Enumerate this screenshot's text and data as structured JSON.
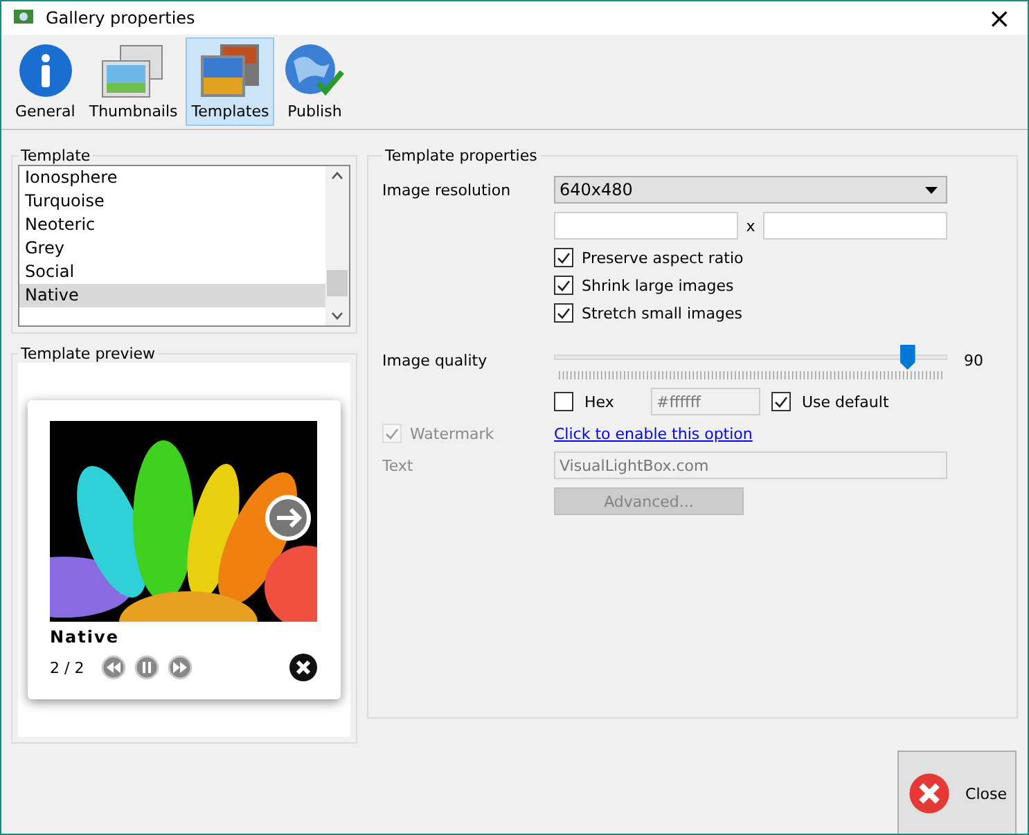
{
  "window": {
    "title": "Gallery properties",
    "close": "×"
  },
  "toolbar": [
    {
      "label": "General",
      "kind": "info",
      "selected": false
    },
    {
      "label": "Thumbnails",
      "kind": "photos",
      "selected": false
    },
    {
      "label": "Templates",
      "kind": "frames",
      "selected": true
    },
    {
      "label": "Publish",
      "kind": "globe",
      "selected": false
    }
  ],
  "template": {
    "title": "Template",
    "items": [
      {
        "label": "Ionosphere",
        "selected": false
      },
      {
        "label": "Turquoise",
        "selected": false
      },
      {
        "label": "Neoteric",
        "selected": false
      },
      {
        "label": "Grey",
        "selected": false
      },
      {
        "label": "Social",
        "selected": false
      },
      {
        "label": "Native",
        "selected": true
      }
    ]
  },
  "preview": {
    "title": "Template preview",
    "caption": "Native",
    "counter": "2 / 2"
  },
  "properties": {
    "title": "Template properties",
    "resolution": {
      "label": "Image resolution",
      "value": "640x480",
      "separator": "x"
    },
    "options": [
      {
        "label": "Preserve aspect ratio",
        "checked": true
      },
      {
        "label": "Shrink large images",
        "checked": true
      },
      {
        "label": "Stretch small images",
        "checked": true
      }
    ],
    "quality": {
      "label": "Image quality",
      "level": 0.9,
      "reading": "90"
    },
    "hex": {
      "label": "Hex",
      "checked": false,
      "value": "#ffffff"
    },
    "use_default": {
      "label": "Use default",
      "checked": true
    },
    "watermark": {
      "label": "Watermark",
      "checked": true,
      "disabled": true,
      "link": "Click to enable this option"
    },
    "text": {
      "label": "Text",
      "value": "VisualLightBox.com",
      "disabled": true
    },
    "advanced": {
      "label": "Advanced...",
      "disabled": true
    }
  },
  "close_button": {
    "label": "Close"
  }
}
